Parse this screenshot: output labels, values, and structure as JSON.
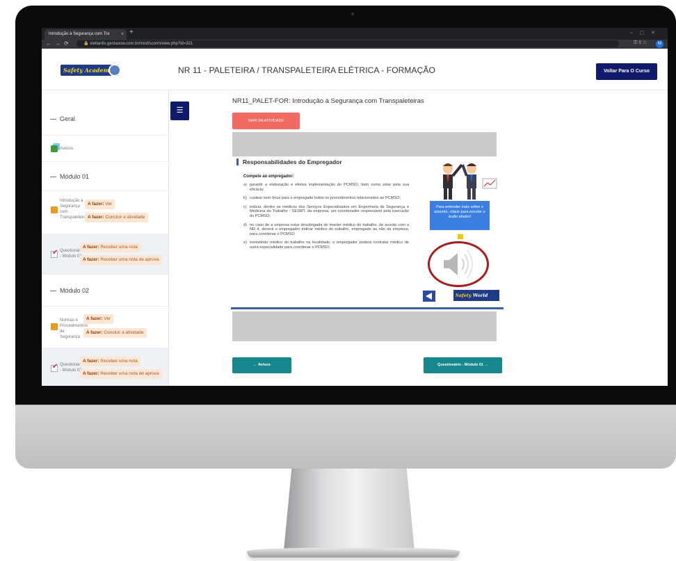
{
  "browser": {
    "tab_title": "Introdução à Segurança com Tra",
    "tab_close": "×",
    "new_tab": "+",
    "url": "stellantis.gestaoow.com.br/mod/scorm/view.php?id=321",
    "profile_initial": "M"
  },
  "header": {
    "logo_text": "Safety Academy",
    "course_title": "NR 11 - PALETEIRA / TRANSPALETEIRA ELÉTRICA - FORMAÇÃO",
    "back_button": "Voltar Para O Curso"
  },
  "sidebar": {
    "sections": [
      {
        "title": "Geral"
      },
      {
        "title": "Módulo 01"
      },
      {
        "title": "Módulo 02"
      }
    ],
    "avisos": "Avisos",
    "m1_item1": {
      "name": "Introdução à Segurança com Transpaleteiras",
      "label1": "A fazer:",
      "text1": "Ver",
      "label2": "A fazer:",
      "text2": "Concluir a atividade"
    },
    "m1_item2": {
      "name": "Questionário - Módulo 01",
      "label1": "A fazer:",
      "text1": "Receber uma nota",
      "label2": "A fazer:",
      "text2": "Receber uma nota de aprova"
    },
    "m2_item1": {
      "name": "Normas e Procedimentos de Segurança",
      "label1": "A fazer:",
      "text1": "Ver",
      "label2": "A fazer:",
      "text2": "Concluir a atividade"
    },
    "m2_item2": {
      "name": "Questionário - Módulo 02",
      "label1": "A fazer:",
      "text1": "Receber uma nota",
      "label2": "A fazer:",
      "text2": "Receber uma nota de aprova"
    }
  },
  "main": {
    "activity_title": "NR11_PALET-FOR: Introdução à Segurança com Transpaleteiras",
    "exit_button": "SAIR DA ATIVIDADE",
    "slide": {
      "title": "Responsabilidades do Empregador",
      "subtitle": "Compete ao empregador:",
      "items": [
        {
          "letter": "a)",
          "text": "garantir a elaboração e efetiva implementação do PCMSO, bem como zelar pela sua eficácia;"
        },
        {
          "letter": "b)",
          "text": "custear sem ônus para o empregado todos os procedimentos relacionados ao PCMSO;"
        },
        {
          "letter": "c)",
          "text": "indicar, dentre os médicos dos Serviços Especializados em Engenharia de Segurança e Medicina do Trabalho - SESMT, da empresa, um coordenador responsável pela execução do PCMSO;"
        },
        {
          "letter": "d)",
          "text": "no caso de a empresa estar desobrigada de manter médico do trabalho, de acordo com a NR 4, deverá o empregador indicar médico do trabalho, empregado ou não da empresa, para coordenar o PCMSO"
        },
        {
          "letter": "e)",
          "text": "inexistindo médico do trabalho na localidade, o empregador poderá contratar médico de outra especialidade para coordenar o PCMSO."
        }
      ],
      "info_box": "Para entender mais sobre o assunto, clique para escutar o áudio abaixo!",
      "logo_left": "Safety",
      "logo_right": "World"
    },
    "prev_button": "← Avisos",
    "next_button": "Questionário - Módulo 01 →"
  }
}
